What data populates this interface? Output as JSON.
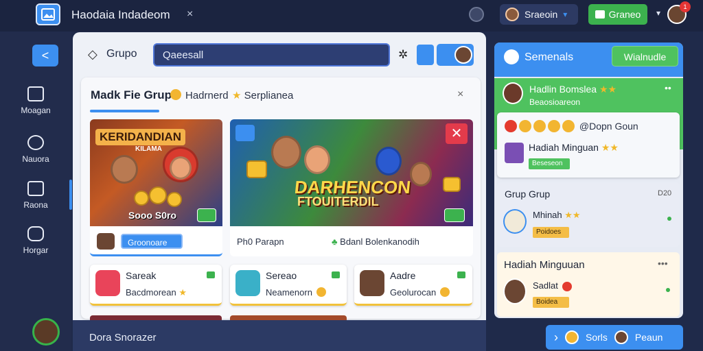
{
  "app": {
    "title": "Haodaia Indadeom",
    "close": "×"
  },
  "topbar": {
    "user_name": "Sraeoin",
    "user_caret": "▾",
    "primary_button": "Graneo",
    "menu_caret": "▾",
    "notification_badge": "1"
  },
  "nav": {
    "items": [
      {
        "label": "Moagan",
        "icon": "folder-icon"
      },
      {
        "label": "Nauora",
        "icon": "chat-icon"
      },
      {
        "label": "Raona",
        "icon": "chart-icon"
      },
      {
        "label": "Horgar",
        "icon": "group-icon"
      }
    ]
  },
  "main": {
    "group_label": "Grupo",
    "search_value": "Qaeesall",
    "card": {
      "title": "Madk Fie Grup",
      "tab2": "Hadrnerd",
      "tab3": "Serplianea",
      "close": "×"
    },
    "tile1": {
      "banner": "KERIDANDIAN",
      "banner_sub": "KILAMA",
      "price": "Sooo S0ro",
      "pill": "Groonoare"
    },
    "tile2": {
      "headline": "DARHENCON",
      "headline2": "FTOUITERDIL",
      "close": "✕",
      "footer_a": "Ph0 Parapn",
      "footer_b": "Bdanl Bolenkanodih"
    },
    "small_cards": [
      {
        "title": "Sareak",
        "sub": "Bacdmorean"
      },
      {
        "title": "Sereao",
        "sub": "Neamenorn"
      },
      {
        "title": "Aadre",
        "sub": "Geolurocan"
      }
    ]
  },
  "bottombar": {
    "text": "Dora Snorazer",
    "action1": "Sorls",
    "action2": "Peaun",
    "arrow": "›"
  },
  "right": {
    "title": "Semenals",
    "button": "Wialnudle",
    "featured": {
      "name": "Hadlin Bomslea",
      "sub": "Beaosioareon",
      "coins_label": "@Dopn Goun",
      "item_title": "Hadiah Minguan",
      "item_pill": "Beseseon"
    },
    "group": {
      "title": "Grup Grup",
      "count": "D20",
      "name": "Mhinah",
      "pill": "Poidoes"
    },
    "hadiah": {
      "title": "Hadiah Minguuan",
      "dots": "•••",
      "name": "Sadlat",
      "pill": "Boidea"
    }
  },
  "colors": {
    "accent": "#3c8ff0",
    "green": "#4fc25f",
    "navy": "#1f2a4a"
  }
}
